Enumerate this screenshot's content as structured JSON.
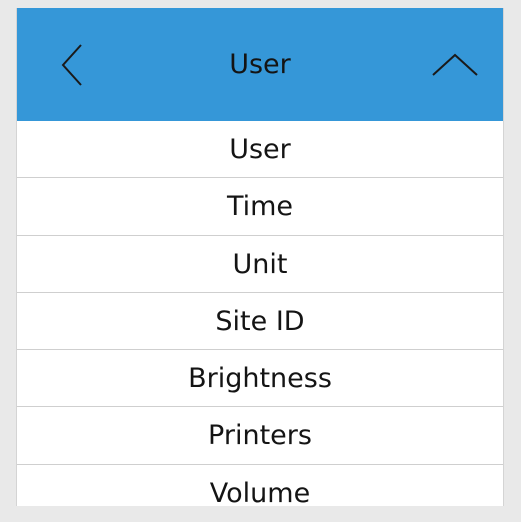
{
  "header": {
    "title": "User",
    "back_icon": "chevron-left-icon",
    "up_icon": "chevron-up-icon",
    "accent_color": "#3597d8"
  },
  "menu": {
    "items": [
      {
        "label": "User"
      },
      {
        "label": "Time"
      },
      {
        "label": "Unit"
      },
      {
        "label": "Site ID"
      },
      {
        "label": "Brightness"
      },
      {
        "label": "Printers"
      },
      {
        "label": "Volume"
      }
    ]
  }
}
